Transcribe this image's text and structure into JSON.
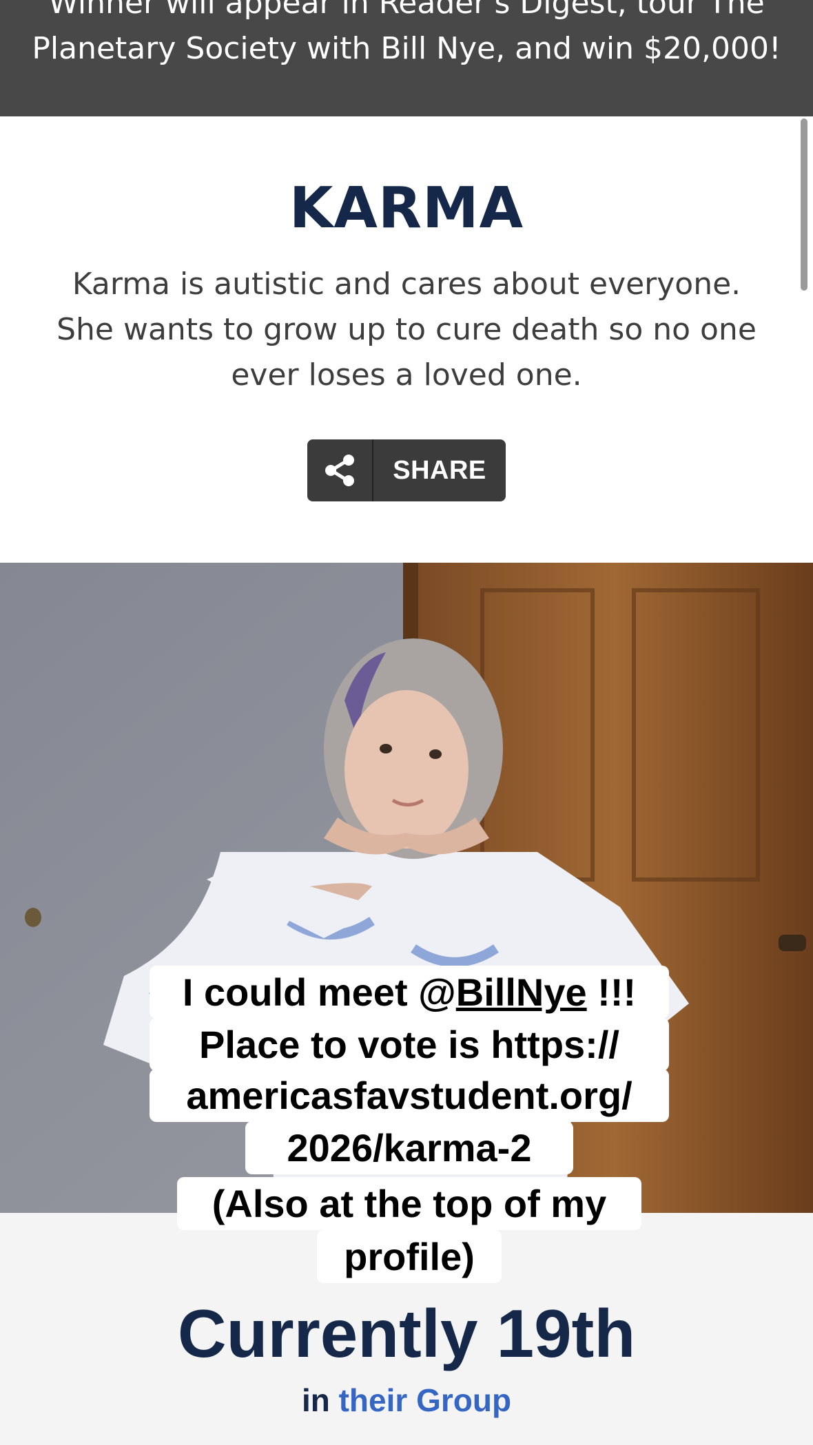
{
  "banner": {
    "line1": "Winner will appear in Reader's Digest, tour The",
    "line2": "Planetary Society with Bill Nye, and win $20,000!"
  },
  "contestant": {
    "name": "KARMA",
    "bio": "Karma is autistic and cares about everyone. She wants to grow up to cure death so no one ever loses a loved one."
  },
  "share": {
    "label": "SHARE",
    "icon": "share-icon"
  },
  "photo": {
    "caption": {
      "line1_pre": "I could meet @",
      "line1_mention": "BillNye",
      "line1_post": " !!!",
      "line2": "Place to vote is https://",
      "line3": "americasfavstudent.org/",
      "line4": "2026/karma-2",
      "line5": "(Also at the top of my",
      "line6": "profile)"
    }
  },
  "standing": {
    "rank_text": "Currently 19th",
    "group_prefix": "in",
    "group_link": "their Group"
  },
  "colors": {
    "banner_bg": "#484848",
    "heading": "#15284a",
    "link": "#3566c4",
    "share_bg": "#3b3b3b"
  }
}
